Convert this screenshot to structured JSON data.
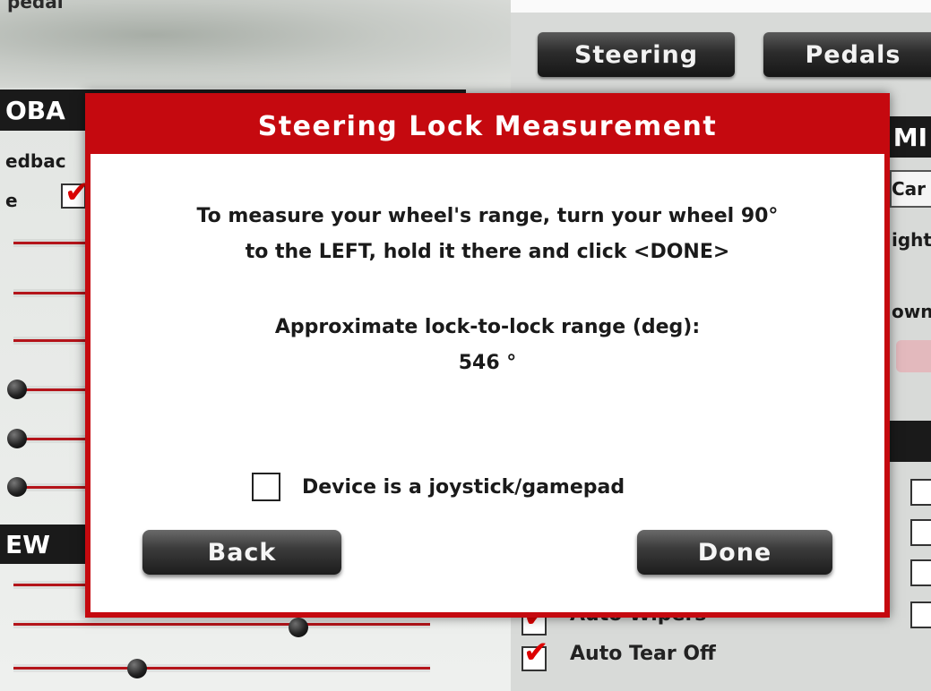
{
  "background": {
    "top_label": "pedal",
    "tabs": {
      "steering": "Steering",
      "pedals": "Pedals"
    },
    "section_feedback": "OBA",
    "section_view": "EW",
    "section_right": "MI",
    "text_feedback": "edbac",
    "text_e": "e",
    "text_car": "Car",
    "text_ight": "ight",
    "text_own": "own",
    "option_wipers": "Auto Wipers",
    "option_tear_off": "Auto Tear Off",
    "accent_color": "#c5090f"
  },
  "dialog": {
    "title": "Steering Lock Measurement",
    "instruction_line1": "To measure your wheel's range, turn your wheel 90°",
    "instruction_line2": "to the LEFT, hold it there and click <DONE>",
    "range_label": "Approximate lock-to-lock range (deg):",
    "range_value": "546 °",
    "joystick_label": "Device is a joystick/gamepad",
    "joystick_checked": false,
    "back_label": "Back",
    "done_label": "Done"
  }
}
